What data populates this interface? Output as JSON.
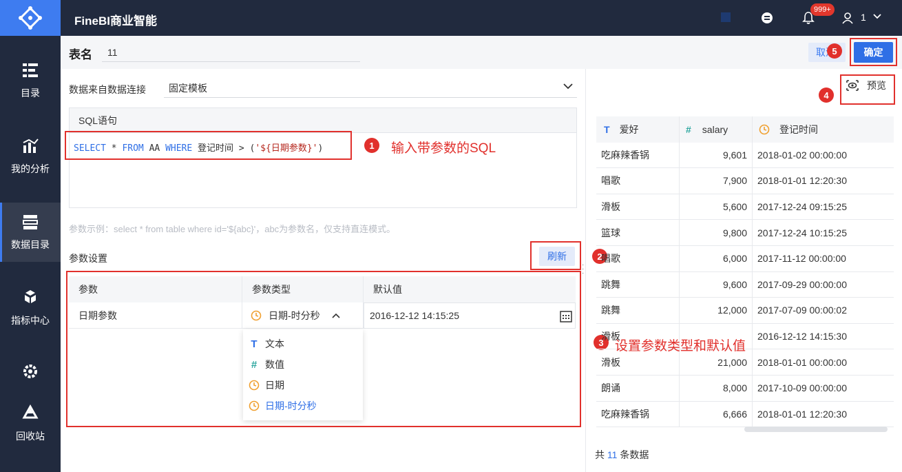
{
  "app": {
    "title": "FineBI商业智能",
    "badge": "999+",
    "user_count": "1"
  },
  "sidebar": {
    "items": [
      {
        "label": "目录",
        "icon": "list-icon"
      },
      {
        "label": "我的分析",
        "icon": "chart-icon"
      },
      {
        "label": "数据目录",
        "icon": "database-icon"
      },
      {
        "label": "指标中心",
        "icon": "cubes-icon"
      },
      {
        "label": "回收站",
        "icon": "recycle-icon"
      }
    ]
  },
  "header": {
    "table_name_label": "表名",
    "table_name_value": "11",
    "cancel_label": "取消",
    "ok_label": "确定"
  },
  "connection": {
    "label": "数据来自数据连接",
    "value": "固定模板"
  },
  "sql": {
    "title": "SQL语句",
    "tokens": [
      "SELECT",
      " * ",
      "FROM",
      " AA ",
      "WHERE",
      " 登记时间 > (",
      "'${日期参数}'",
      ")"
    ]
  },
  "hint": "参数示例：select * from table where id='${abc}'，abc为参数名，仅支持直连模式。",
  "params": {
    "title": "参数设置",
    "refresh_label": "刷新",
    "columns": [
      "参数",
      "参数类型",
      "默认值"
    ],
    "row": {
      "name": "日期参数",
      "type": "日期-时分秒",
      "default": "2016-12-12 14:15:25"
    },
    "type_options": [
      {
        "label": "文本",
        "icon": "text-icon"
      },
      {
        "label": "数值",
        "icon": "number-icon"
      },
      {
        "label": "日期",
        "icon": "clock-icon"
      },
      {
        "label": "日期-时分秒",
        "icon": "clock-icon",
        "selected": true
      }
    ]
  },
  "annotations": {
    "a1": {
      "num": "1",
      "text": "输入带参数的SQL"
    },
    "a2": {
      "num": "2"
    },
    "a3": {
      "num": "3",
      "text": "设置参数类型和默认值"
    },
    "a4": {
      "num": "4"
    },
    "a5": {
      "num": "5"
    }
  },
  "preview": {
    "label": "预览",
    "columns": [
      {
        "name": "爱好",
        "icon": "text-icon"
      },
      {
        "name": "salary",
        "icon": "number-icon"
      },
      {
        "name": "登记时间",
        "icon": "clock-icon"
      }
    ],
    "rows": [
      [
        "吃麻辣香锅",
        "9,601",
        "2018-01-02 00:00:00"
      ],
      [
        "唱歌",
        "7,900",
        "2018-01-01 12:20:30"
      ],
      [
        "滑板",
        "5,600",
        "2017-12-24 09:15:25"
      ],
      [
        "篮球",
        "9,800",
        "2017-12-24 10:15:25"
      ],
      [
        "唱歌",
        "6,000",
        "2017-11-12 00:00:00"
      ],
      [
        "跳舞",
        "9,600",
        "2017-09-29 00:00:00"
      ],
      [
        "跳舞",
        "12,000",
        "2017-07-09 00:00:02"
      ],
      [
        "滑板",
        "",
        "2016-12-12 14:15:30"
      ],
      [
        "滑板",
        "21,000",
        "2018-01-01 00:00:00"
      ],
      [
        "朗诵",
        "8,000",
        "2017-10-09 00:00:00"
      ],
      [
        "吃麻辣香锅",
        "6,666",
        "2018-01-01 12:20:30"
      ]
    ],
    "total_prefix": "共",
    "total_count": "11",
    "total_suffix": "条数据"
  },
  "colors": {
    "accent": "#2f6fe6",
    "sidebar_bg": "#212a3e",
    "annotation_red": "#e1302c",
    "clock_orange": "#f0a030",
    "number_teal": "#2fa8a0"
  }
}
